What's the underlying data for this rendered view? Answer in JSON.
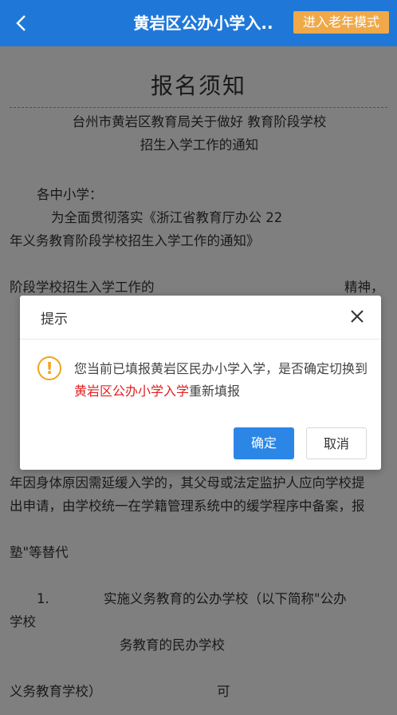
{
  "header": {
    "title": "黄岩区公办小学入..",
    "elder_mode_label": "进入老年模式"
  },
  "document": {
    "title": "报名须知",
    "subtitle_line1": "台州市黄岩区教育局关于做好 教育阶段学校",
    "subtitle_line2": "招生入学工作的通知",
    "greeting": "各中小学：",
    "p1_line1": "为全面贯彻落实《浙江省教育厅办公 22",
    "p1_line2": "年义务教育阶段学校招生入学工作的通知》",
    "p1_line3": "阶段学校招生入学工作的",
    "p1_tail": "精神，",
    "p2_line1": "年因身体原因需延缓入学的，其父母或法定监护人应向学校提",
    "p2_line2": "出申请，由学校统一在学籍管理系统中的缓学程序中备案，报",
    "p2_line3": "塾\"等替代",
    "p3_line1": "1.",
    "p3_line1b": "实施义务教育的公办学校（以下简称\"公办",
    "p3_line2": "学校",
    "p3_line3": "务教育的民办学校",
    "p3_line4": "义务教育学校）",
    "p3_line4b": "可"
  },
  "dialog": {
    "title": "提示",
    "message_prefix": "您当前已填报黄岩区民办小学入学，是否确定切换到",
    "message_highlight": "黄岩区公办小学入学",
    "message_suffix": "重新填报",
    "confirm_label": "确定",
    "cancel_label": "取消"
  },
  "colors": {
    "header_bg": "#1f78d8",
    "elder_button_bg": "#f0a948",
    "primary_button": "#2b86e6",
    "warning_icon": "#f3a21c",
    "highlight_text": "#e02020"
  }
}
